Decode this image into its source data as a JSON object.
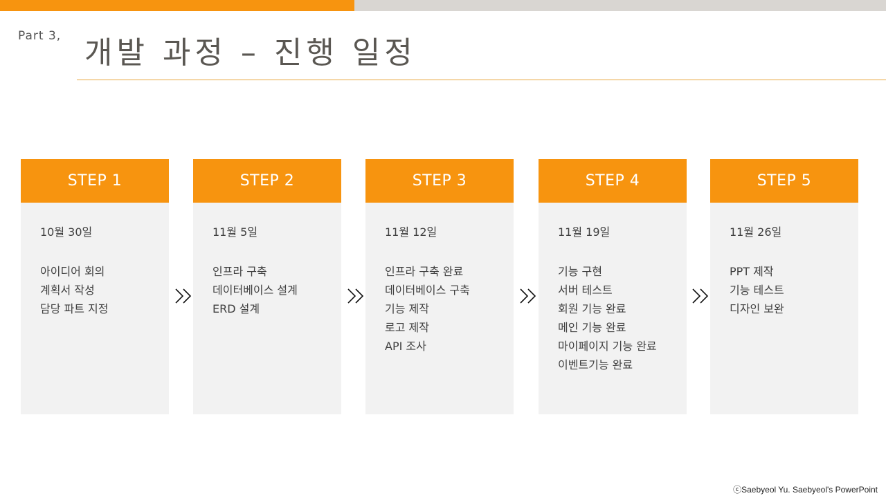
{
  "header": {
    "part": "Part  3,",
    "title": "개발 과정 – 진행 일정"
  },
  "steps": [
    {
      "label": "STEP 1",
      "date": "10월 30일",
      "items": [
        "아이디어 회의",
        "계획서 작성",
        "담당 파트 지정"
      ]
    },
    {
      "label": "STEP 2",
      "date": "11월 5일",
      "items": [
        "인프라 구축",
        "데이터베이스 설계",
        "ERD 설계"
      ]
    },
    {
      "label": "STEP 3",
      "date": "11월 12일",
      "items": [
        "인프라 구축 완료",
        "데이터베이스 구축",
        "기능 제작",
        "로고 제작",
        "API 조사"
      ]
    },
    {
      "label": "STEP 4",
      "date": "11월 19일",
      "items": [
        "기능 구현",
        "서버 테스트",
        "회원 기능 완료",
        "메인 기능 완료",
        "마이페이지 기능 완료",
        "이벤트기능 완료"
      ]
    },
    {
      "label": "STEP 5",
      "date": "11월 26일",
      "items": [
        "PPT 제작",
        "기능 테스트",
        "디자인 보완"
      ]
    }
  ],
  "footer": {
    "credit": "ⓒSaebyeol Yu. Saebyeol's PowerPoint"
  },
  "colors": {
    "accent": "#f7940f",
    "bar_gray": "#d9d6d2",
    "card_bg": "#f2f2f2",
    "rule": "#e8a43a"
  },
  "icons": {
    "separator": "double-chevron-right-icon"
  }
}
